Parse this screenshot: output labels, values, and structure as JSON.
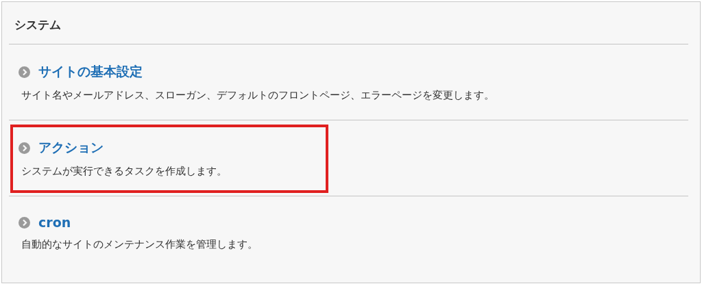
{
  "panel": {
    "title": "システム"
  },
  "items": [
    {
      "title": "サイトの基本設定",
      "description": "サイト名やメールアドレス、スローガン、デフォルトのフロントページ、エラーページを変更します。",
      "highlighted": false
    },
    {
      "title": "アクション",
      "description": "システムが実行できるタスクを作成します。",
      "highlighted": true
    },
    {
      "title": "cron",
      "description": "自動的なサイトのメンテナンス作業を管理します。",
      "highlighted": false
    }
  ]
}
